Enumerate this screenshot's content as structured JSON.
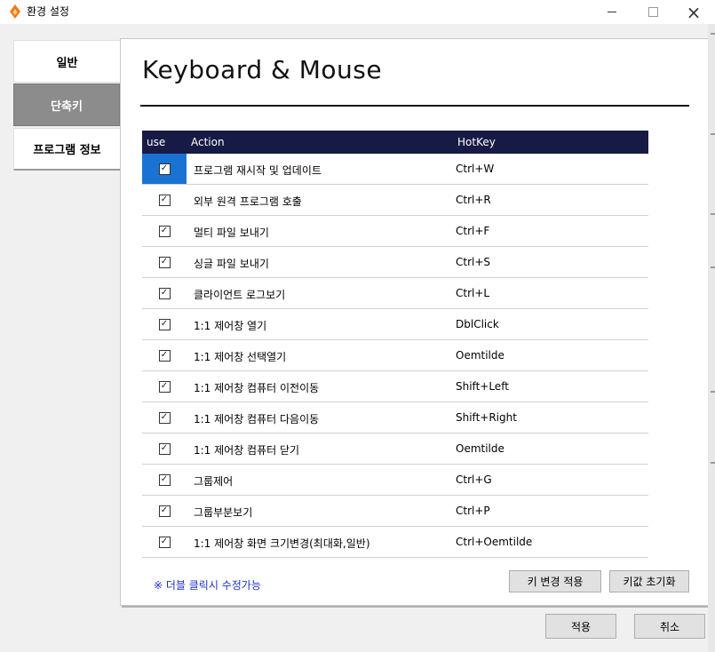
{
  "window": {
    "title": "환경 설정",
    "icon": "orange-diamond-app-icon",
    "controls": {
      "minimize": "minimize-icon",
      "maximize": "maximize-icon",
      "close": "×"
    }
  },
  "sidebar": {
    "items": [
      {
        "label": "일반",
        "selected": false
      },
      {
        "label": "단축키",
        "selected": true
      },
      {
        "label": "프로그램 정보",
        "selected": false
      }
    ]
  },
  "main": {
    "heading": "Keyboard & Mouse",
    "table": {
      "headers": {
        "use": "use",
        "action": "Action",
        "hotkey": "HotKey"
      },
      "rows": [
        {
          "use": true,
          "action": "프로그램 재시작 및 업데이트",
          "hotkey": "Ctrl+W"
        },
        {
          "use": true,
          "action": "외부 원격 프로그램 호출",
          "hotkey": "Ctrl+R"
        },
        {
          "use": true,
          "action": "멀티 파일 보내기",
          "hotkey": "Ctrl+F"
        },
        {
          "use": true,
          "action": "싱글 파일 보내기",
          "hotkey": "Ctrl+S"
        },
        {
          "use": true,
          "action": "클라이언트 로그보기",
          "hotkey": "Ctrl+L"
        },
        {
          "use": true,
          "action": "1:1 제어창 열기",
          "hotkey": "DblClick"
        },
        {
          "use": true,
          "action": "1:1 제어창 선택열기",
          "hotkey": "Oemtilde"
        },
        {
          "use": true,
          "action": "1:1 제어창 컴퓨터 이전이동",
          "hotkey": "Shift+Left"
        },
        {
          "use": true,
          "action": "1:1 제어창 컴퓨터 다음이동",
          "hotkey": "Shift+Right"
        },
        {
          "use": true,
          "action": "1:1 제어창 컴퓨터 닫기",
          "hotkey": "Oemtilde"
        },
        {
          "use": true,
          "action": "그룹제어",
          "hotkey": "Ctrl+G"
        },
        {
          "use": true,
          "action": "그룹부분보기",
          "hotkey": "Ctrl+P"
        },
        {
          "use": true,
          "action": "1:1 제어창 화면 크기변경(최대화,일반)",
          "hotkey": "Ctrl+Oemtilde"
        }
      ]
    },
    "hint": "※ 더블 클릭시 수정가능",
    "apply_key_label": "키 변경 적용",
    "reset_key_label": "키값 초기화"
  },
  "footer": {
    "ok_label": "적용",
    "cancel_label": "취소"
  },
  "colors": {
    "header_bg": "#161a45",
    "selected_cell": "#1a73d3",
    "active_tab": "#8c8c8c",
    "hint_text": "#1a30c8",
    "app_icon": "#f07a1a"
  }
}
